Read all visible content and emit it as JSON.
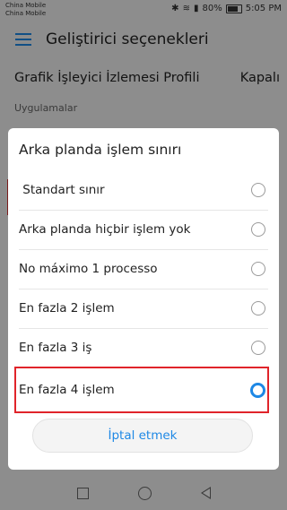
{
  "status": {
    "carrier1": "China Mobile",
    "carrier2": "China Mobile",
    "battery": "80%",
    "time": "5:05 PM"
  },
  "appbar": {
    "title": "Geliştirici seçenekleri"
  },
  "settings": {
    "gpu_label": "Grafik İşleyici İzlemesi Profili",
    "gpu_value": "Kapalı",
    "section": "Uygulamalar"
  },
  "dialog": {
    "title": "Arka planda işlem sınırı",
    "options": [
      {
        "label": " Standart sınır",
        "selected": false
      },
      {
        "label": "Arka planda hiçbir işlem yok",
        "selected": false
      },
      {
        "label": "No máximo 1 processo",
        "selected": false
      },
      {
        "label": "En fazla 2 işlem",
        "selected": false
      },
      {
        "label": "En fazla 3 iş",
        "selected": false
      },
      {
        "label": "En fazla 4 işlem",
        "selected": true
      }
    ],
    "cancel": "İptal etmek"
  },
  "colors": {
    "accent": "#1e88e5",
    "highlight": "#e0242a"
  }
}
